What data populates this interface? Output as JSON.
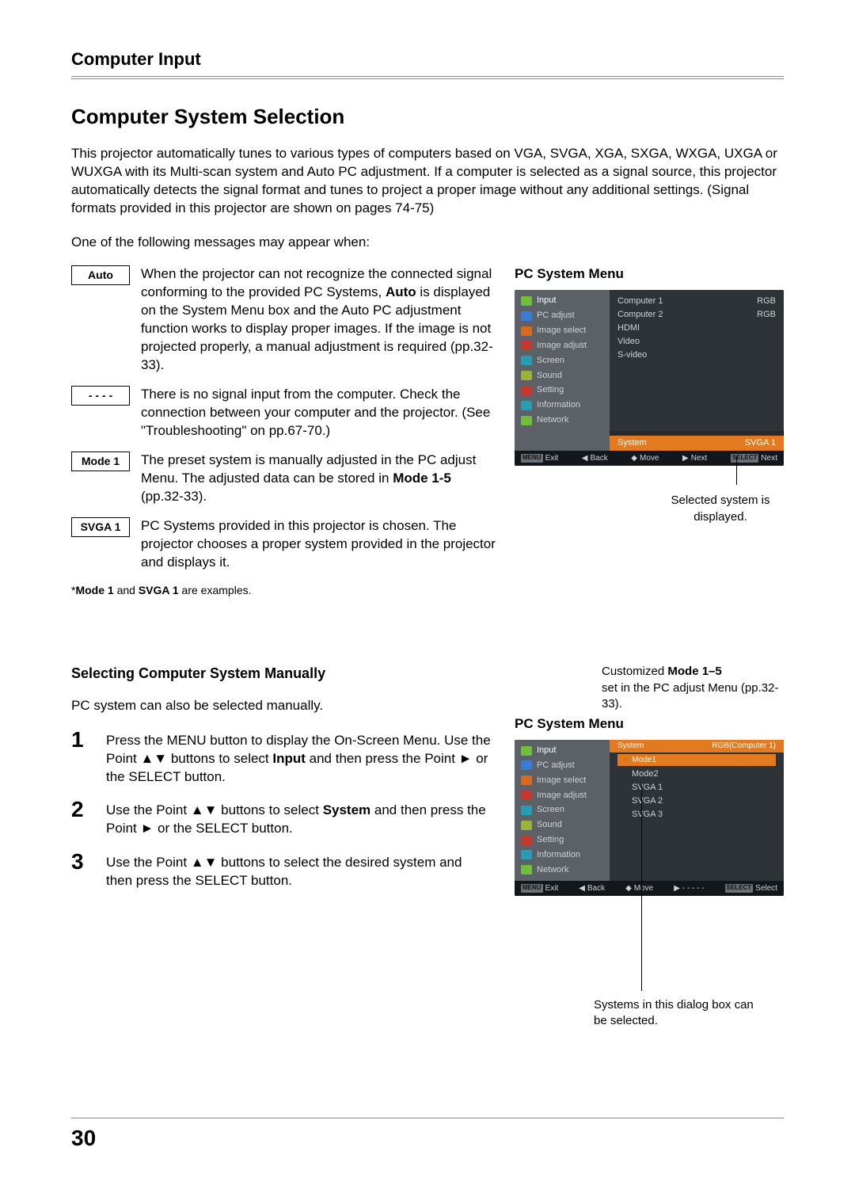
{
  "header": {
    "section": "Computer Input"
  },
  "title": "Computer System Selection",
  "intro": "This projector automatically tunes to various types of computers based on VGA, SVGA, XGA, SXGA, WXGA, UXGA or WUXGA with its Multi-scan system and Auto PC adjustment. If a computer is selected as a signal source, this projector automatically detects the signal format and tunes to project a proper image without any additional settings. (Signal formats provided in this projector are shown on pages 74-75)",
  "lead": "One of the following messages may appear when:",
  "messages": [
    {
      "label": "Auto",
      "text_before": "When the projector can not recognize the connected signal conforming to the provided PC Systems, ",
      "bold": "Auto",
      "text_after": " is displayed on the System Menu box and the Auto PC adjustment function works to display proper images.  If the image is not projected properly, a manual adjustment is required (pp.32-33)."
    },
    {
      "label": "- - - -",
      "text_before": "There is no signal input from the computer. Check the connection between your computer and the projector. (See \"Troubleshooting\" on pp.67-70.)",
      "bold": "",
      "text_after": ""
    },
    {
      "label": "Mode 1",
      "text_before": "The preset system is manually adjusted in the PC adjust Menu. The adjusted data can be stored in ",
      "bold": "Mode 1-5",
      "text_after": " (pp.32-33)."
    },
    {
      "label": "SVGA 1",
      "text_before": "PC Systems provided in this projector is chosen. The projector chooses a proper system provided in the projector and displays it.",
      "bold": "",
      "text_after": ""
    }
  ],
  "footnote_pre": "*",
  "footnote_b1": "Mode 1",
  "footnote_mid": " and ",
  "footnote_b2": "SVGA 1",
  "footnote_post": " are examples.",
  "side_heading_1": "PC System Menu",
  "osd1": {
    "side": [
      "Input",
      "PC adjust",
      "Image select",
      "Image adjust",
      "Screen",
      "Sound",
      "Setting",
      "Information",
      "Network"
    ],
    "icon_colors": [
      "#6fbf3a",
      "#3a7bd5",
      "#d66b1f",
      "#c0392b",
      "#2b9bb3",
      "#9bb33a",
      "#c0392b",
      "#2b9bb3",
      "#6fbf3a"
    ],
    "main": [
      [
        "Computer 1",
        "RGB"
      ],
      [
        "Computer 2",
        "RGB"
      ],
      [
        "HDMI",
        ""
      ],
      [
        "Video",
        ""
      ],
      [
        "S-video",
        ""
      ]
    ],
    "highlight_l": "System",
    "highlight_r": "SVGA 1",
    "foot": {
      "exit_k": "MENU",
      "exit": "Exit",
      "back": "Back",
      "move": "Move",
      "next": "Next",
      "sel_k": "SELECT",
      "sel": "Next"
    }
  },
  "caption1": "Selected system is displayed.",
  "sub_heading": "Selecting Computer System Manually",
  "sub_lead": "PC system can also be selected manually.",
  "steps": [
    {
      "n": "1",
      "pre": "Press the MENU button to display the On-Screen Menu. Use the Point ▲▼ buttons to select ",
      "b": "Input",
      "post": " and then press the Point ► or the SELECT button."
    },
    {
      "n": "2",
      "pre": "Use the Point ▲▼ buttons to select ",
      "b": "System",
      "post": " and then press the Point ► or the SELECT button."
    },
    {
      "n": "3",
      "pre": "Use the Point ▲▼ buttons to select the desired system and then press the SELECT button.",
      "b": "",
      "post": ""
    }
  ],
  "annot_top_pre": "Customized ",
  "annot_top_b": "Mode 1–5",
  "annot_top_post": " set in the PC adjust Menu (pp.32-33).",
  "side_heading_2": "PC System Menu",
  "osd2": {
    "side": [
      "Input",
      "PC adjust",
      "Image select",
      "Image adjust",
      "Screen",
      "Sound",
      "Setting",
      "Information",
      "Network"
    ],
    "icon_colors": [
      "#6fbf3a",
      "#3a7bd5",
      "#d66b1f",
      "#c0392b",
      "#2b9bb3",
      "#9bb33a",
      "#c0392b",
      "#2b9bb3",
      "#6fbf3a"
    ],
    "hdr_l": "System",
    "hdr_r": "RGB(Computer 1)",
    "sel": "Mode1",
    "list": [
      "Mode2",
      "SVGA 1",
      "SVGA 2",
      "SVGA 3"
    ],
    "foot": {
      "exit_k": "MENU",
      "exit": "Exit",
      "back": "Back",
      "move": "Move",
      "next": "- - - - -",
      "sel_k": "SELECT",
      "sel": "Select"
    }
  },
  "caption2": "Systems in this dialog box can be selected.",
  "page_number": "30"
}
